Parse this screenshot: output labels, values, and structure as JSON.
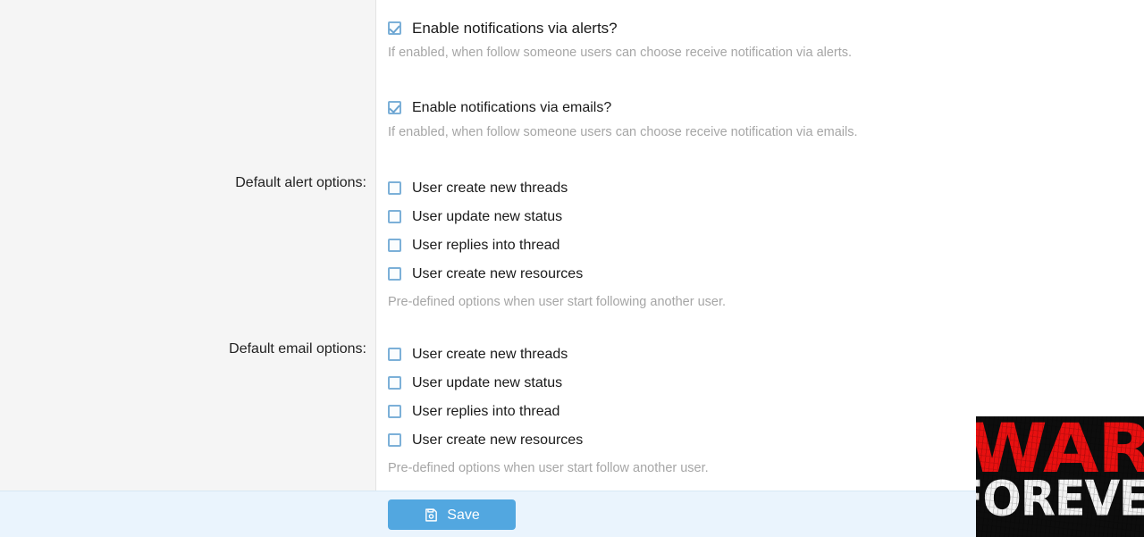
{
  "form": {
    "toggles": [
      {
        "id": "alerts",
        "label": "Enable notifications via alerts?",
        "checked": true,
        "help": "If enabled, when follow someone users can choose receive notification via alerts."
      },
      {
        "id": "emails",
        "label": "Enable notifications via emails?",
        "checked": true,
        "help": "If enabled, when follow someone users can choose receive notification via emails."
      }
    ],
    "option_groups": [
      {
        "id": "default-alert-options",
        "label": "Default alert options:",
        "options": [
          {
            "label": "User create new threads",
            "checked": false
          },
          {
            "label": "User update new status",
            "checked": false
          },
          {
            "label": "User replies into thread",
            "checked": false
          },
          {
            "label": "User create new resources",
            "checked": false
          }
        ],
        "help": "Pre-defined options when user start following another user."
      },
      {
        "id": "default-email-options",
        "label": "Default email options:",
        "options": [
          {
            "label": "User create new threads",
            "checked": false
          },
          {
            "label": "User update new status",
            "checked": false
          },
          {
            "label": "User replies into thread",
            "checked": false
          },
          {
            "label": "User create new resources",
            "checked": false
          }
        ],
        "help": "Pre-defined options when user start follow another user."
      }
    ],
    "footer": {
      "save_label": "Save",
      "save_icon": "floppy-disk-save-icon"
    }
  },
  "overlay_banner": {
    "line1": "WAR",
    "line2": "FOREVER",
    "line1_color": "#e81010",
    "line2_color": "#f2f2f2",
    "background_color": "#0d0d0d"
  },
  "colors": {
    "accent": "#52a7e0",
    "checkbox_border": "#7cb0d8",
    "gutter_background": "#f5f5f5",
    "footer_background": "#eaf4fd",
    "help_text": "#a6a6a6"
  }
}
